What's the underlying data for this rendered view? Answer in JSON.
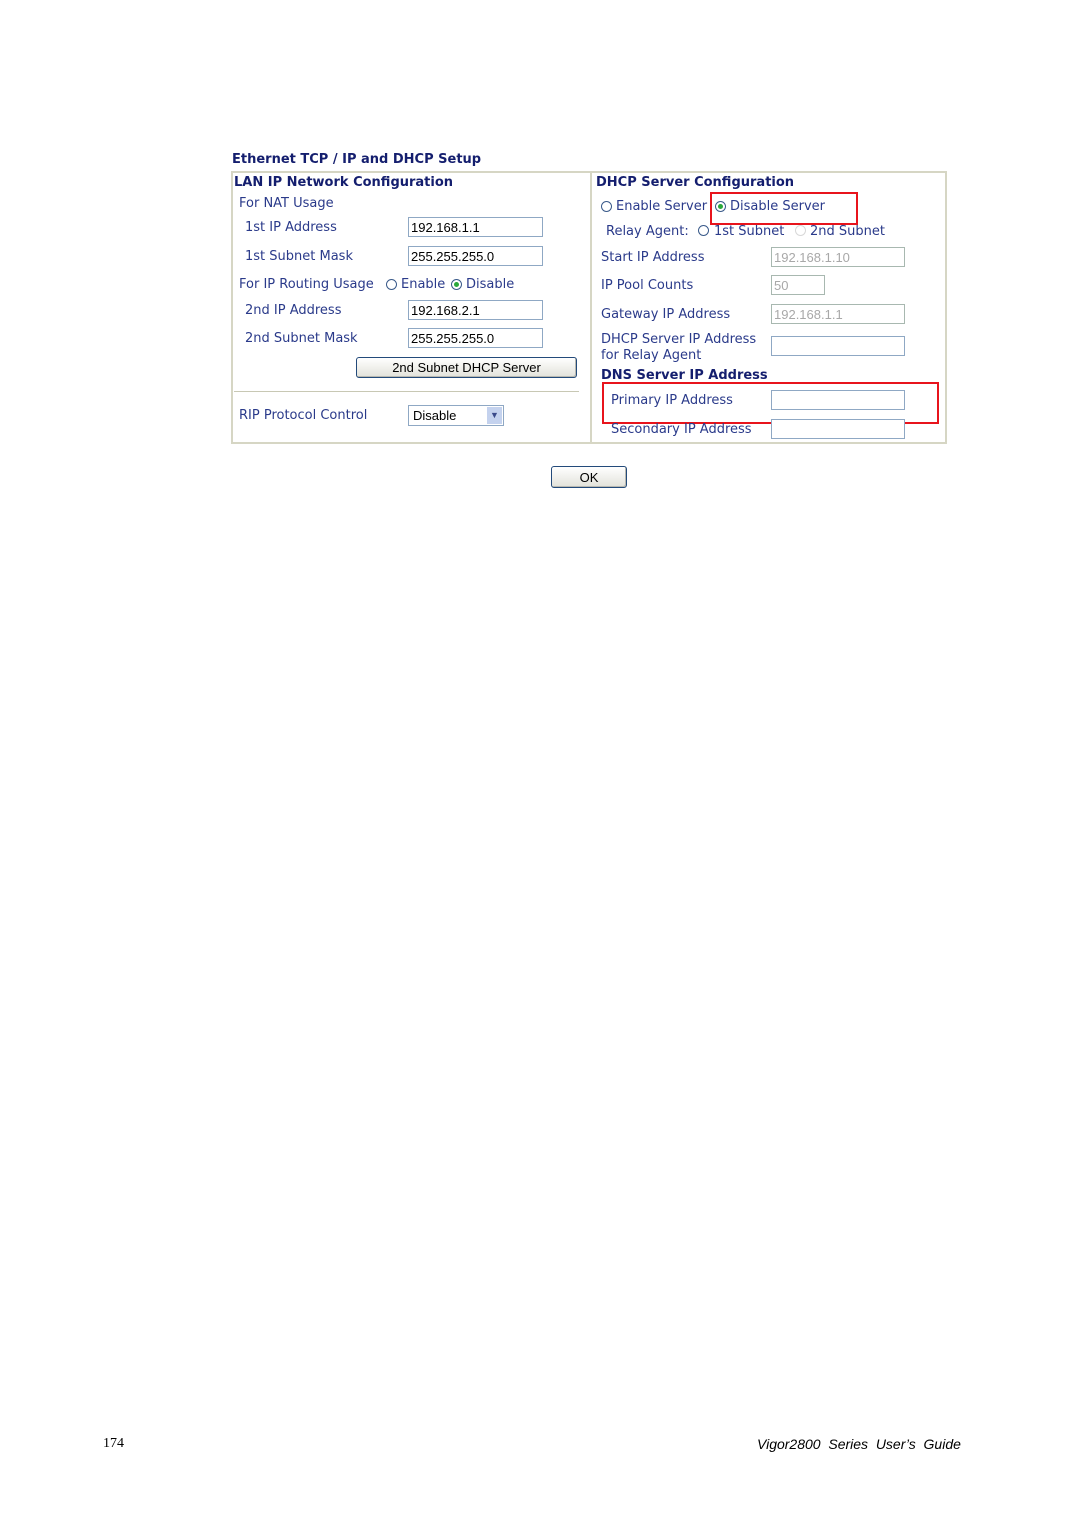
{
  "title": "Ethernet TCP / IP and DHCP Setup",
  "lan": {
    "heading": "LAN IP Network Configuration",
    "nat_label": "For NAT Usage",
    "ip1_label": "1st IP Address",
    "ip1_value": "192.168.1.1",
    "mask1_label": "1st Subnet Mask",
    "mask1_value": "255.255.255.0",
    "routing_label": "For IP Routing Usage",
    "routing_enable": "Enable",
    "routing_disable": "Disable",
    "routing_selected": "Disable",
    "ip2_label": "2nd IP Address",
    "ip2_value": "192.168.2.1",
    "mask2_label": "2nd Subnet Mask",
    "mask2_value": "255.255.255.0",
    "dhcp2_button": "2nd Subnet DHCP Server",
    "rip_label": "RIP Protocol Control",
    "rip_value": "Disable"
  },
  "dhcp": {
    "heading": "DHCP Server Configuration",
    "enable_label": "Enable Server",
    "disable_label": "Disable Server",
    "selected": "Disable Server",
    "relay_label": "Relay Agent:",
    "relay_1st": "1st Subnet",
    "relay_2nd": "2nd Subnet",
    "start_label": "Start IP Address",
    "start_value": "192.168.1.10",
    "pool_label": "IP Pool Counts",
    "pool_value": "50",
    "gateway_label": "Gateway IP Address",
    "gateway_value": "192.168.1.1",
    "relay_server_label1": "DHCP Server IP Address",
    "relay_server_label2": "for Relay Agent",
    "relay_server_value": "",
    "dns_heading": "DNS Server IP Address",
    "primary_label": "Primary IP Address",
    "primary_value": "",
    "secondary_label": "Secondary IP Address",
    "secondary_value": ""
  },
  "ok_button": "OK",
  "footer": {
    "page_number": "174",
    "guide_title": "Vigor2800  Series  User’s  Guide"
  },
  "colors": {
    "highlight": "#e8141c",
    "text": "#2a3a8a"
  }
}
